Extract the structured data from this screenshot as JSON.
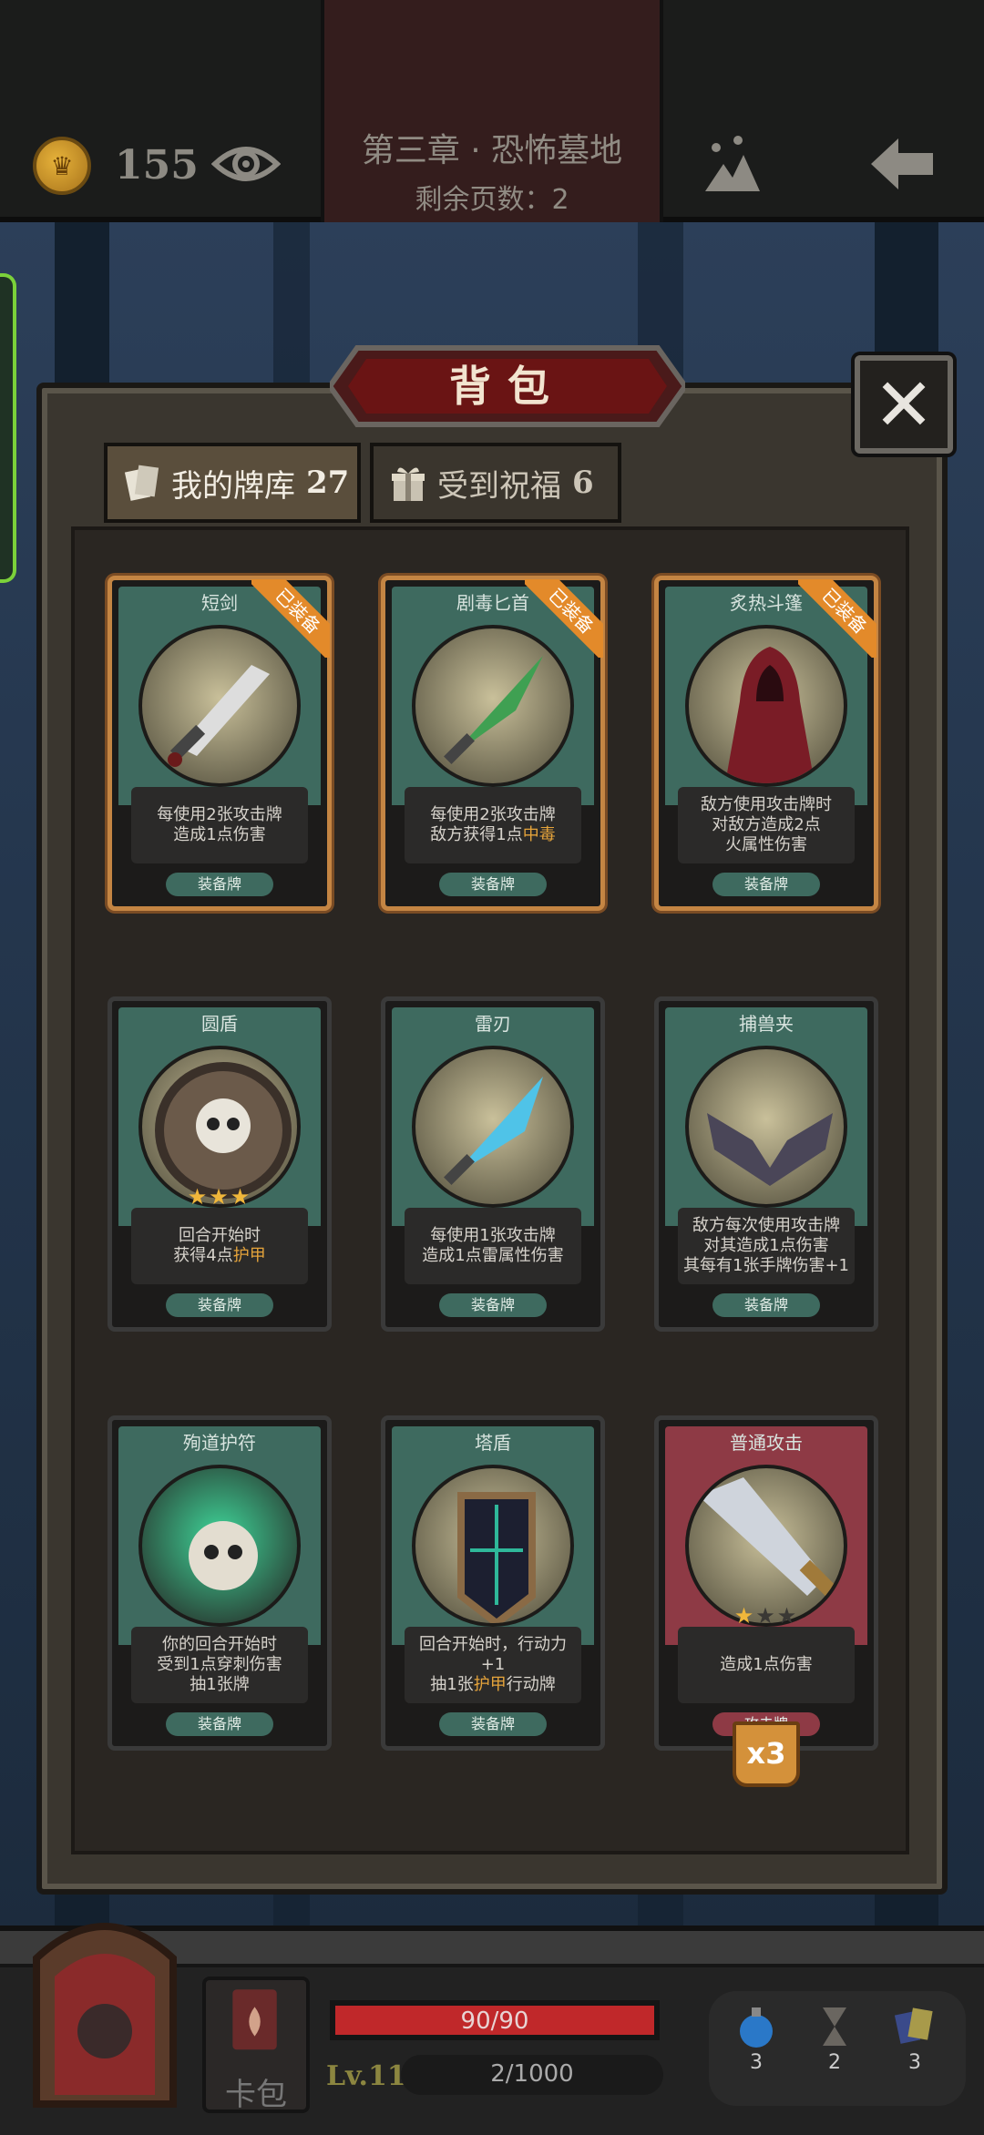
{
  "topbar": {
    "coins": "155",
    "chapter_title": "第三章 · 恐怖墓地",
    "pages_left": "剩余页数：2"
  },
  "panel": {
    "title": "背包",
    "close_glyph": "✕",
    "tabs": [
      {
        "label": "我的牌库",
        "count": "27",
        "active": true
      },
      {
        "label": "受到祝福",
        "count": "6",
        "active": false
      }
    ]
  },
  "cards": [
    {
      "name": "短剑",
      "desc": [
        "每使用2张攻击牌",
        "造成1点伤害"
      ],
      "type": "装备牌",
      "equipped_label": "已装备"
    },
    {
      "name": "剧毒匕首",
      "desc": [
        "每使用2张攻击牌",
        "敌方获得1点",
        "中毒"
      ],
      "type": "装备牌",
      "equipped_label": "已装备"
    },
    {
      "name": "炙热斗篷",
      "desc": [
        "敌方使用攻击牌时",
        "对敌方造成2点",
        "火属性伤害"
      ],
      "type": "装备牌",
      "equipped_label": "已装备"
    },
    {
      "name": "圆盾",
      "desc": [
        "回合开始时",
        "获得4点",
        "护甲"
      ],
      "type": "装备牌",
      "stars": "★★★"
    },
    {
      "name": "雷刃",
      "desc": [
        "每使用1张攻击牌",
        "造成1点雷属性伤害"
      ],
      "type": "装备牌"
    },
    {
      "name": "捕兽夹",
      "desc": [
        "敌方每次使用攻击牌",
        "对其造成1点伤害",
        "其每有1张手牌伤害+1"
      ],
      "type": "装备牌"
    },
    {
      "name": "殉道护符",
      "desc": [
        "你的回合开始时",
        "受到1点穿刺伤害",
        "抽1张牌"
      ],
      "type": "装备牌"
    },
    {
      "name": "塔盾",
      "desc": [
        "回合开始时，行动力+1",
        "抽1张",
        "护甲",
        "行动牌"
      ],
      "type": "装备牌"
    },
    {
      "name": "普通攻击",
      "desc": [
        "造成1点伤害"
      ],
      "type": "攻击牌",
      "stars_on": "★",
      "stars_off": "★★",
      "count": "x3"
    }
  ],
  "hud": {
    "bag_label": "卡包",
    "hp": "90/90",
    "hp_fraction": 1.0,
    "level": "Lv.11",
    "xp": "2/1000",
    "resources": [
      {
        "icon": "potion-icon",
        "value": "3"
      },
      {
        "icon": "hourglass-icon",
        "value": "2"
      },
      {
        "icon": "cards-icon",
        "value": "3"
      }
    ]
  },
  "colors": {
    "equip_green": "#3e6a5f",
    "attack_red": "#8e3a45",
    "equipped_orange": "#e38a2a",
    "hp_red": "#c0282a"
  }
}
